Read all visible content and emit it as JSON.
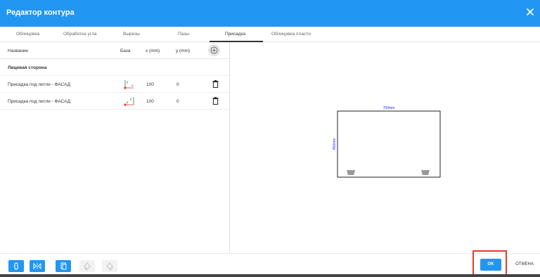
{
  "dialog": {
    "title": "Редактор контура"
  },
  "tabs": [
    {
      "label": "Облицовка"
    },
    {
      "label": "Обработка угла"
    },
    {
      "label": "Вырезы"
    },
    {
      "label": "Пазы"
    },
    {
      "label": "Присадка",
      "active": true
    },
    {
      "label": "Облицовка пласти"
    }
  ],
  "table": {
    "headers": {
      "name": "Название",
      "base": "База",
      "x": "x (mm)",
      "y": "y (mm)"
    },
    "section": "Лицевая сторона",
    "rows": [
      {
        "name": "Присадка под петли - ФАСАД",
        "x": "100",
        "y": "0",
        "base_icon": "base-corner-bottom-left-icon"
      },
      {
        "name": "Присадка под петли - ФАСАД",
        "x": "100",
        "y": "0",
        "base_icon": "base-corner-bottom-right-icon"
      }
    ]
  },
  "preview": {
    "width_label": "700mm",
    "height_label": "450mm"
  },
  "footer": {
    "ok": "OK",
    "cancel": "ОТМЕНА"
  },
  "colors": {
    "primary": "#2196f3",
    "dimension": "#1a1aff",
    "highlight": "#e53935"
  }
}
